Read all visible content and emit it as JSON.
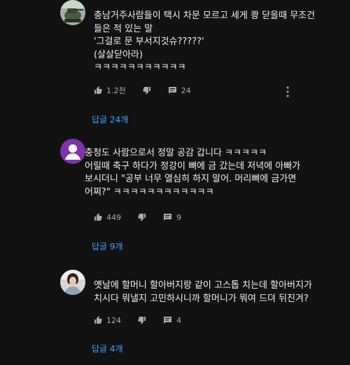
{
  "comments": [
    {
      "avatar": "tank-photo-avatar",
      "text": "충남거주사람들이 택시 차문 모르고 세게 쾅 닫을때 무조건\n들은 적 있는 말\n'그걸로 문 부서지것슈?????'\n(살살닫아라)\nㅋㅋㅋㅋㅋㅋㅋㅋㅋㅋㅋ",
      "likes": "1.2천",
      "replies_count": "24",
      "replies_link": "답글 24개"
    },
    {
      "avatar": "default-purple-avatar",
      "text": "충청도 사람으로서 정말 공감 갑니다 ㅋㅋㅋㅋㅋ\n어릴때 축구 하다가 정강이 뼈에 금 갔는데 저녁에 아빠가\n보시더니 \"공부 너무 열심히 하지 말어. 머리뼈에 금가면\n어쩌?\" ㅋㅋㅋㅋㅋㅋㅋㅋㅋㅋㅋㅋ",
      "likes": "449",
      "replies_count": "9",
      "replies_link": "답글 9개"
    },
    {
      "avatar": "person-photo-avatar",
      "text": "옛날에 할머니 할아버지랑 같이 고스톱 치는데 할아버지가\n치시다 뭐낼지 고민하시니까 할머니가 뭐여 드뎌 뒤진겨?",
      "likes": "124",
      "replies_count": "4",
      "replies_link": "답글 4개"
    }
  ],
  "colors": {
    "background": "#121212",
    "text": "#f0f0f0",
    "meta": "#aaaaaa",
    "link": "#3ea6ff",
    "purple_avatar": "#7b35a8"
  }
}
